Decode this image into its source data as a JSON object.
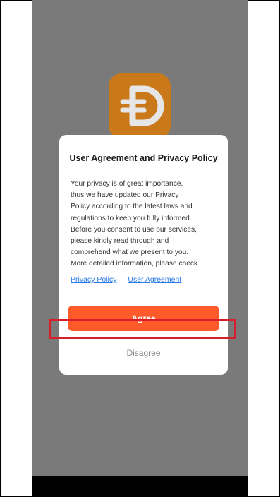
{
  "dialog": {
    "title": "User Agreement and Privacy Policy",
    "body_lines": [
      "Your privacy is of great importance,",
      "thus we have updated our Privacy",
      "Policy according to the latest laws and",
      "regulations to keep you fully informed.",
      "Before you consent to use our services,",
      "please kindly read through and",
      "comprehend what we present to you.",
      " More detailed information, please check"
    ],
    "links": {
      "privacy_policy": "Privacy Policy",
      "user_agreement": "User Agreement"
    },
    "agree_label": "Agree",
    "disagree_label": "Disagree"
  },
  "colors": {
    "backdrop": "#7a7a7a",
    "logo_background": "#c9791a",
    "accent": "#ff5a2a",
    "link": "#2c7be5",
    "highlight": "#d91d2a"
  },
  "icons": {
    "app_logo": "app-logo-icon"
  }
}
